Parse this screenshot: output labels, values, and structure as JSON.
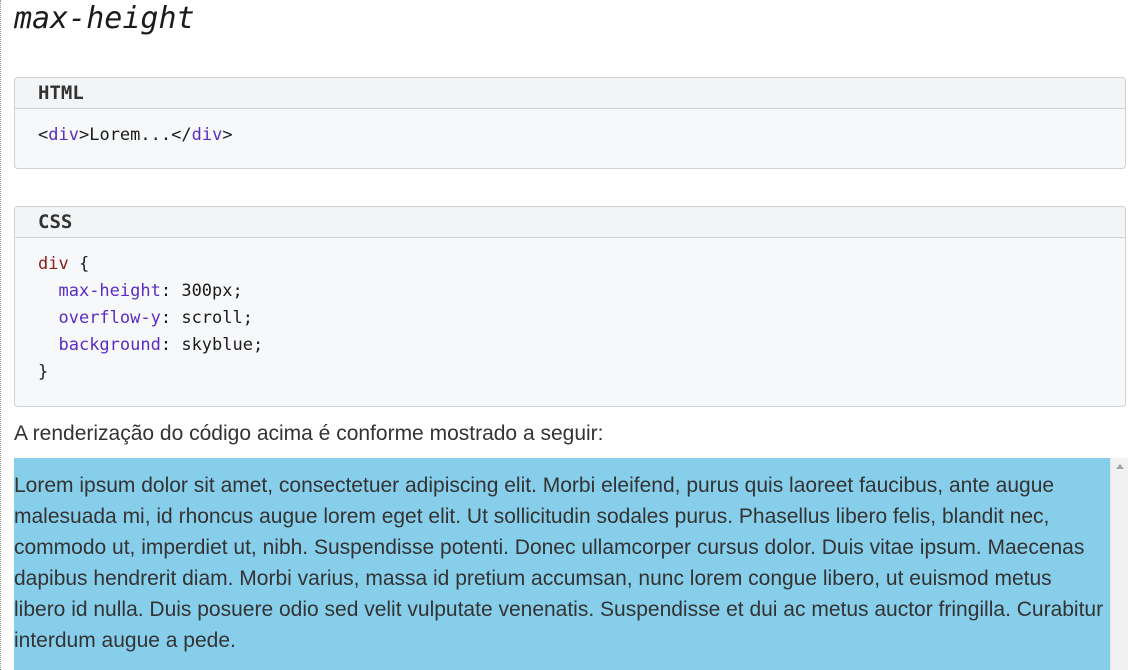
{
  "page": {
    "heading": "max-height"
  },
  "html_example": {
    "header_label": "HTML",
    "code": {
      "open_lt": "<",
      "open_tag": "div",
      "open_gt": ">",
      "content": "Lorem...",
      "close_lt": "</",
      "close_tag": "div",
      "close_gt": ">"
    }
  },
  "css_example": {
    "header_label": "CSS",
    "selector": "div",
    "open_brace": " {",
    "declarations": [
      {
        "property": "max-height",
        "value": "300px"
      },
      {
        "property": "overflow-y",
        "value": "scroll"
      },
      {
        "property": "background",
        "value": "skyblue"
      }
    ],
    "close_brace": "}"
  },
  "render": {
    "caption": "A renderização do código acima é conforme mostrado a seguir:",
    "demo_text": "Lorem ipsum dolor sit amet, consectetuer adipiscing elit. Morbi eleifend, purus quis laoreet faucibus, ante augue malesuada mi, id rhoncus augue lorem eget elit. Ut sollicitudin sodales purus. Phasellus libero felis, blandit nec, commodo ut, imperdiet ut, nibh. Suspendisse potenti. Donec ullamcorper cursus dolor. Duis vitae ipsum. Maecenas dapibus hendrerit diam. Morbi varius, massa id pretium accumsan, nunc lorem congue libero, ut euismod metus libero id nulla. Duis posuere odio sed velit vulputate venenatis. Suspendisse et dui ac metus auctor fringilla. Curabitur interdum augue a pede.",
    "demo_background": "#87ceeb"
  },
  "colors": {
    "code_tag": "#5a2cc4",
    "code_selector": "#8a1c1c",
    "code_property": "#5a2cc4",
    "code_box_background": "#f7f8f9"
  },
  "icons": {
    "scroll_up": "chevron-up-icon"
  }
}
